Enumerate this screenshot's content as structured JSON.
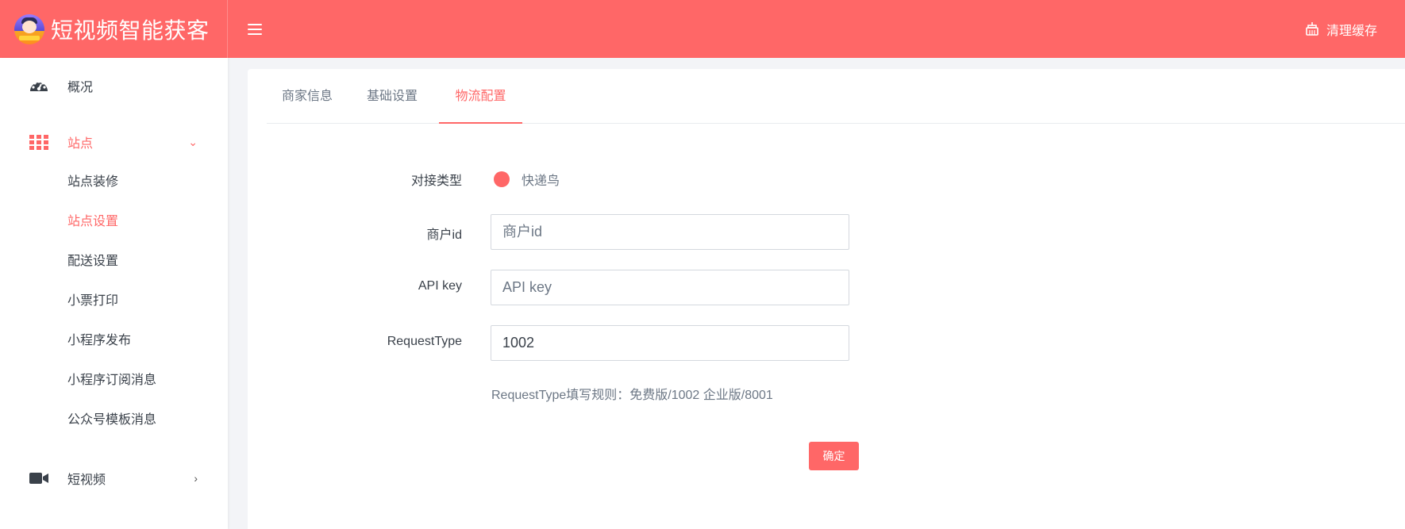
{
  "app": {
    "title": "短视频智能获客"
  },
  "header": {
    "clear_cache_label": "清理缓存"
  },
  "sidebar": {
    "overview": "概况",
    "site": "站点",
    "site_items": [
      "站点装修",
      "站点设置",
      "配送设置",
      "小票打印",
      "小程序发布",
      "小程序订阅消息",
      "公众号模板消息"
    ],
    "short_video": "短视频"
  },
  "tabs": [
    "商家信息",
    "基础设置",
    "物流配置"
  ],
  "active_tab": "物流配置",
  "form": {
    "type_label": "对接类型",
    "type_option": "快递鸟",
    "merchant_id_label": "商户id",
    "merchant_id_placeholder": "商户id",
    "merchant_id_value": "",
    "api_key_label": "API key",
    "api_key_placeholder": "API key",
    "api_key_value": "",
    "request_type_label": "RequestType",
    "request_type_value": "1002",
    "hint": "RequestType填写规则：免费版/1002 企业版/8001",
    "submit": "确定"
  },
  "colors": {
    "brand": "#ff6767",
    "text": "#3a414a",
    "muted": "#6c7785"
  }
}
